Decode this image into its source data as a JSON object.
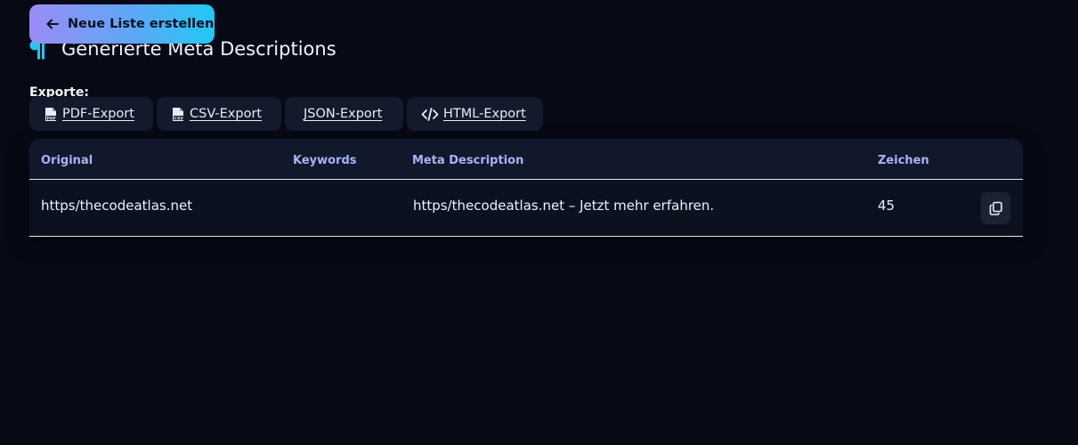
{
  "back_button": {
    "label": "Neue Liste erstellen",
    "icon": "arrow-left-icon"
  },
  "page": {
    "title": "Generierte Meta Descriptions",
    "title_icon": "pilcrow-icon",
    "accent_color": "#22c8f2"
  },
  "exports": {
    "label": "Exporte:",
    "buttons": [
      {
        "label": "PDF-Export ",
        "icon": "pdf-file-icon"
      },
      {
        "label": "CSV-Export ",
        "icon": "csv-file-icon"
      },
      {
        "label": "JSON-Export ",
        "icon": ""
      },
      {
        "label": "HTML-Export",
        "icon": "code-icon"
      }
    ]
  },
  "table": {
    "headers": [
      "Original",
      "Keywords",
      "Meta Description",
      "Zeichen"
    ],
    "rows": [
      {
        "original": "https/thecodeatlas.net",
        "keywords": "",
        "meta_description": "https/thecodeatlas.net – Jetzt mehr erfahren.",
        "zeichen": "45",
        "action_icon": "copy-icon"
      }
    ]
  }
}
